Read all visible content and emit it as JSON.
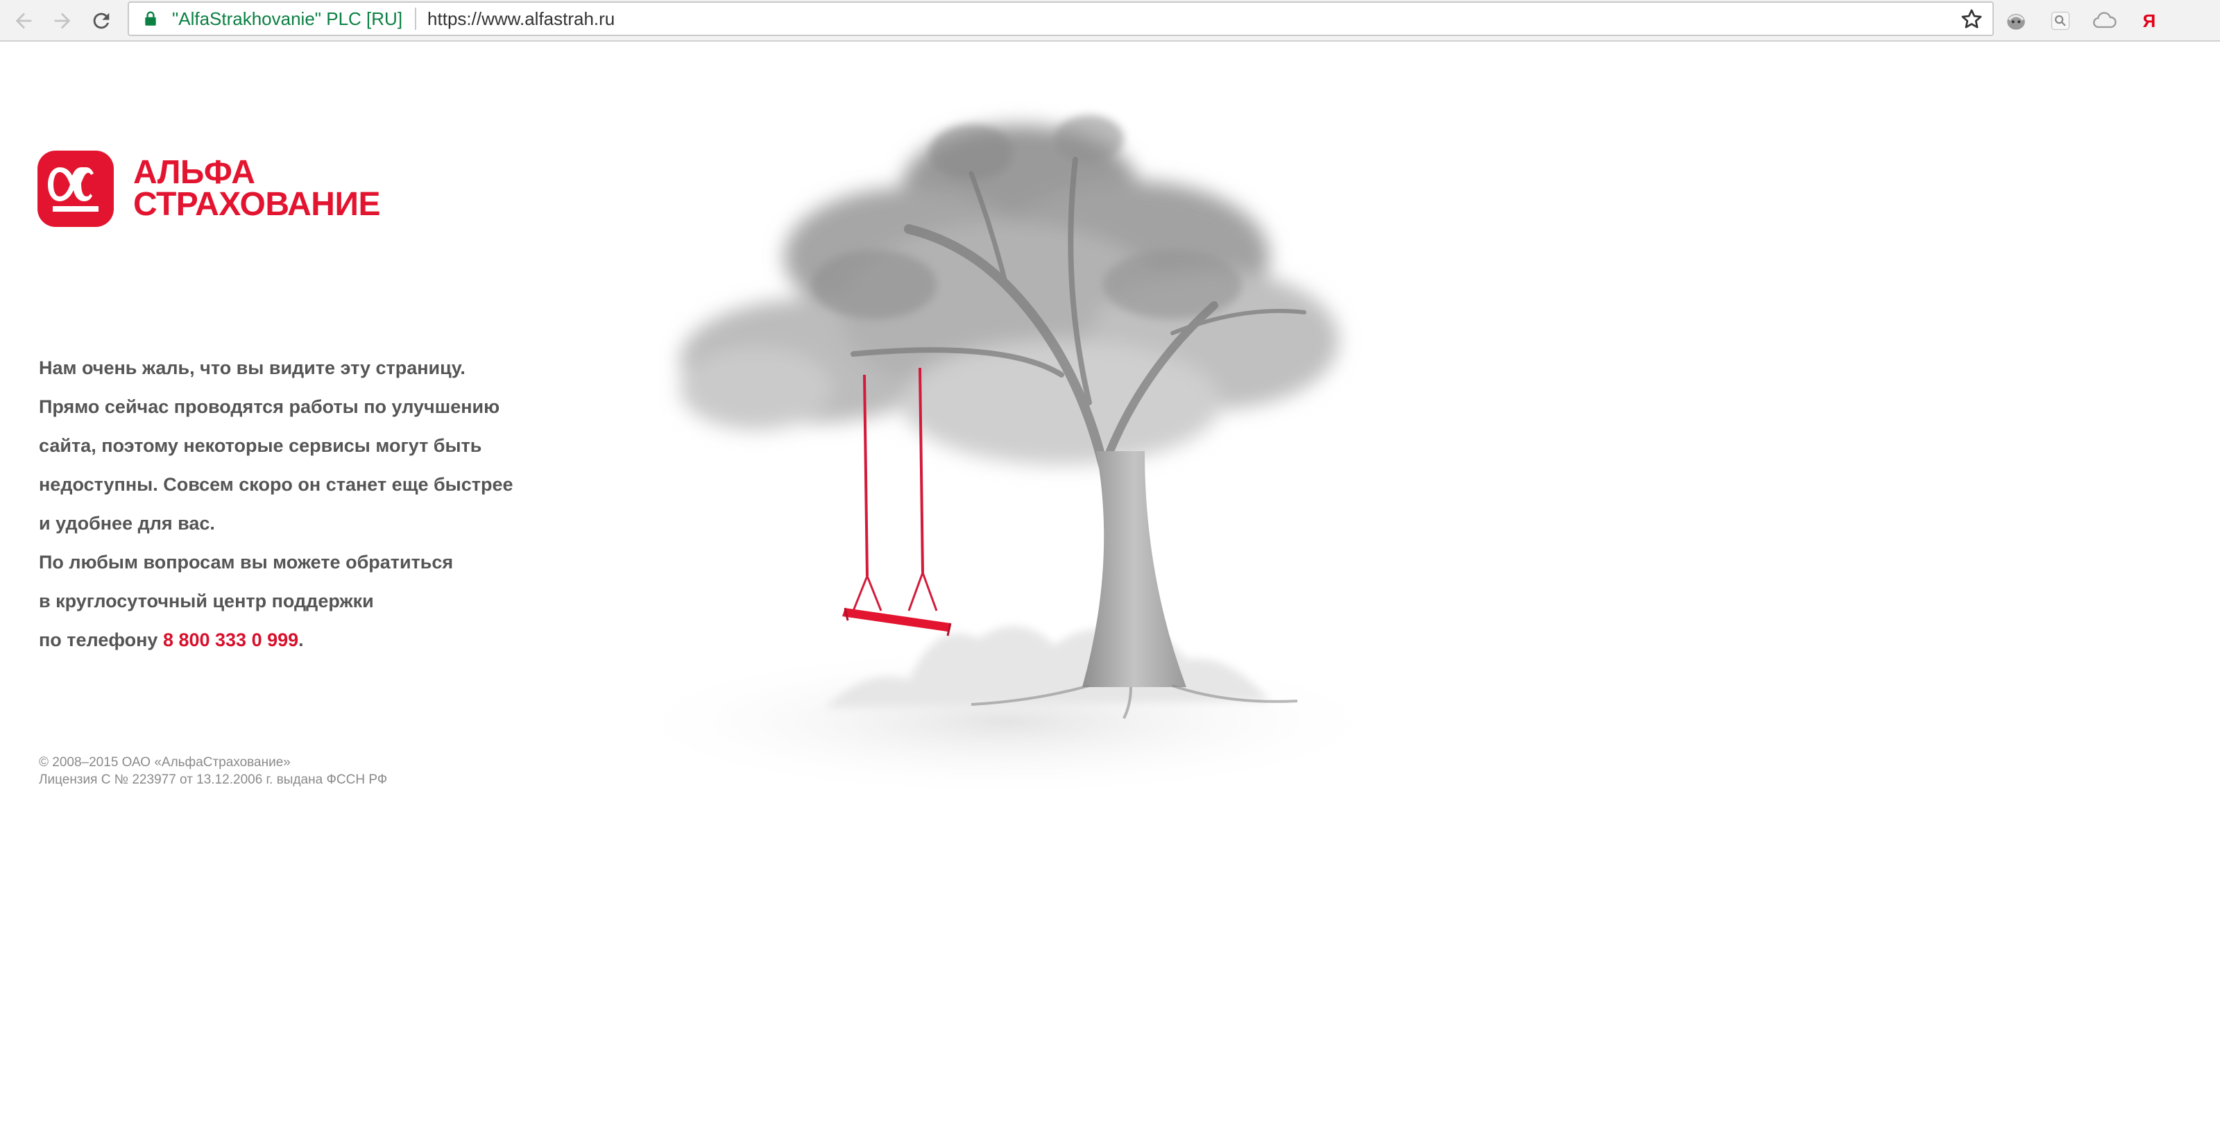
{
  "browser": {
    "site_identity": "\"AlfaStrakhovanie\" PLC [RU]",
    "url": "https://www.alfastrah.ru",
    "extensions": [
      "privacy-badger-icon",
      "search-extension-icon",
      "cloud-icon",
      "yandex-icon"
    ],
    "yandex_label": "Я"
  },
  "brand": {
    "line1": "АЛЬФА",
    "line2": "СТРАХОВАНИЕ",
    "color": "#e3142f"
  },
  "message": {
    "lines": [
      "Нам очень жаль, что вы видите эту страницу.",
      "Прямо сейчас проводятся работы по улучшению",
      "сайта, поэтому некоторые сервисы могут быть",
      "недоступны. Совсем скоро он станет еще быстрее",
      "и удобнее для вас.",
      "По любым вопросам вы можете обратиться",
      "в круглосуточный центр поддержки"
    ],
    "phone_prefix": "по телефону ",
    "phone": "8 800 333 0 999",
    "phone_suffix": "."
  },
  "footer": {
    "copyright": "© 2008–2015 ОАО «АльфаСтрахование»",
    "license": "Лицензия С № 223977 от 13.12.2006 г. выдана ФССН РФ"
  }
}
